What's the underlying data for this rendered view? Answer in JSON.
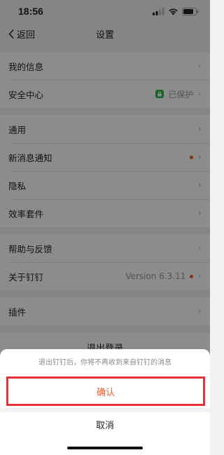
{
  "status": {
    "time": "18:56"
  },
  "nav": {
    "back_label": "返回",
    "title": "设置"
  },
  "groups": [
    [
      {
        "label": "我的信息"
      },
      {
        "label": "安全中心",
        "value": "已保护"
      }
    ],
    [
      {
        "label": "通用"
      },
      {
        "label": "新消息通知"
      },
      {
        "label": "隐私"
      },
      {
        "label": "效率套件"
      }
    ],
    [
      {
        "label": "帮助与反馈"
      },
      {
        "label": "关于钉钉",
        "value": "Version 6.3.11"
      }
    ],
    [
      {
        "label": "插件"
      }
    ]
  ],
  "logout_label": "退出登录",
  "sheet": {
    "message": "退出钉钉后，你将不再收到来自钉钉的消息",
    "confirm_label": "确认",
    "cancel_label": "取消"
  },
  "colors": {
    "accent": "#f25a2c",
    "highlight_border": "#e8303a",
    "secure_green": "#28b34b"
  }
}
